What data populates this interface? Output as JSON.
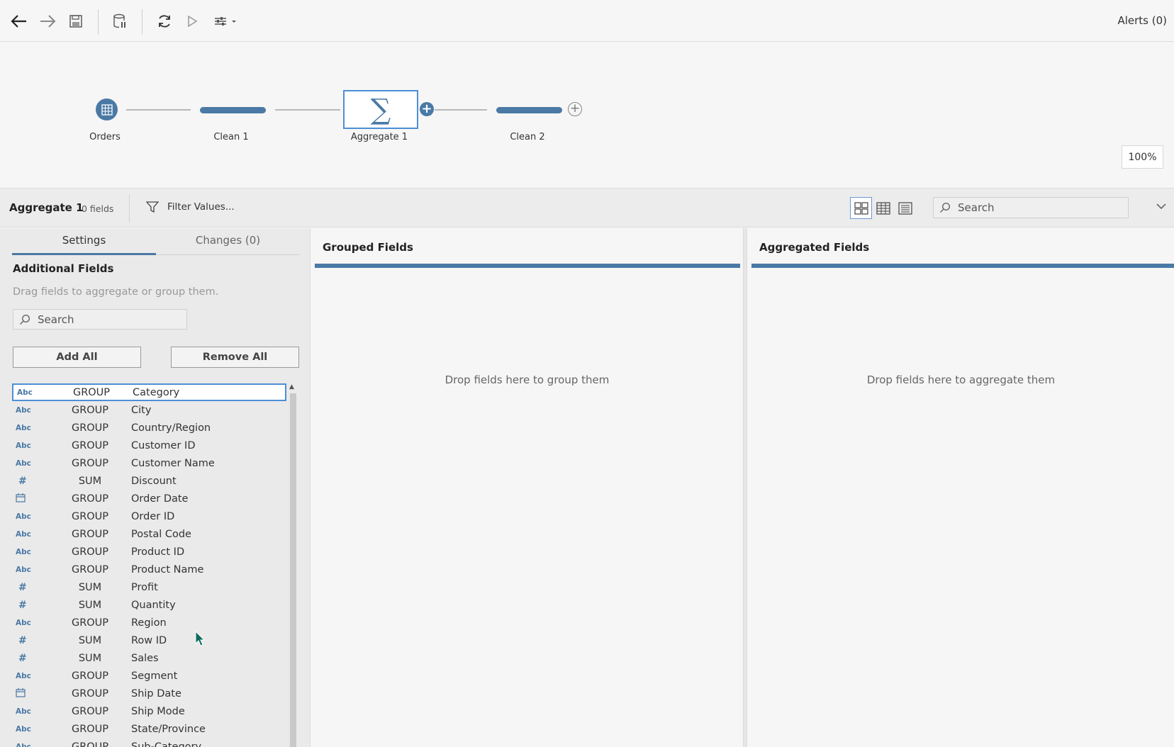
{
  "toolbar": {
    "alerts_label": "Alerts (0)"
  },
  "flow": {
    "nodes": [
      {
        "label": "Orders"
      },
      {
        "label": "Clean 1"
      },
      {
        "label": "Aggregate 1"
      },
      {
        "label": "Clean 2"
      }
    ],
    "zoom": "100%"
  },
  "header": {
    "title": "Aggregate 1",
    "field_count": "0 fields",
    "filter_label": "Filter Values...",
    "search_placeholder": "Search"
  },
  "left_panel": {
    "tabs": [
      "Settings",
      "Changes (0)"
    ],
    "section_title": "Additional Fields",
    "hint": "Drag fields to aggregate or group them.",
    "search_placeholder": "Search",
    "add_all": "Add All",
    "remove_all": "Remove All",
    "fields": [
      {
        "type": "Abc",
        "agg": "GROUP",
        "name": "Category"
      },
      {
        "type": "Abc",
        "agg": "GROUP",
        "name": "City"
      },
      {
        "type": "Abc",
        "agg": "GROUP",
        "name": "Country/Region"
      },
      {
        "type": "Abc",
        "agg": "GROUP",
        "name": "Customer ID"
      },
      {
        "type": "Abc",
        "agg": "GROUP",
        "name": "Customer Name"
      },
      {
        "type": "#",
        "agg": "SUM",
        "name": "Discount"
      },
      {
        "type": "date",
        "agg": "GROUP",
        "name": "Order Date"
      },
      {
        "type": "Abc",
        "agg": "GROUP",
        "name": "Order ID"
      },
      {
        "type": "Abc",
        "agg": "GROUP",
        "name": "Postal Code"
      },
      {
        "type": "Abc",
        "agg": "GROUP",
        "name": "Product ID"
      },
      {
        "type": "Abc",
        "agg": "GROUP",
        "name": "Product Name"
      },
      {
        "type": "#",
        "agg": "SUM",
        "name": "Profit"
      },
      {
        "type": "#",
        "agg": "SUM",
        "name": "Quantity"
      },
      {
        "type": "Abc",
        "agg": "GROUP",
        "name": "Region"
      },
      {
        "type": "#",
        "agg": "SUM",
        "name": "Row ID"
      },
      {
        "type": "#",
        "agg": "SUM",
        "name": "Sales"
      },
      {
        "type": "Abc",
        "agg": "GROUP",
        "name": "Segment"
      },
      {
        "type": "date",
        "agg": "GROUP",
        "name": "Ship Date"
      },
      {
        "type": "Abc",
        "agg": "GROUP",
        "name": "Ship Mode"
      },
      {
        "type": "Abc",
        "agg": "GROUP",
        "name": "State/Province"
      },
      {
        "type": "Abc",
        "agg": "GROUP",
        "name": "Sub-Category"
      }
    ]
  },
  "grouped": {
    "title": "Grouped Fields",
    "drop_hint": "Drop fields here to group them"
  },
  "aggregated": {
    "title": "Aggregated Fields",
    "drop_hint": "Drop fields here to aggregate them"
  },
  "colors": {
    "accent": "#4a79a5",
    "selection": "#4d8fd6"
  }
}
